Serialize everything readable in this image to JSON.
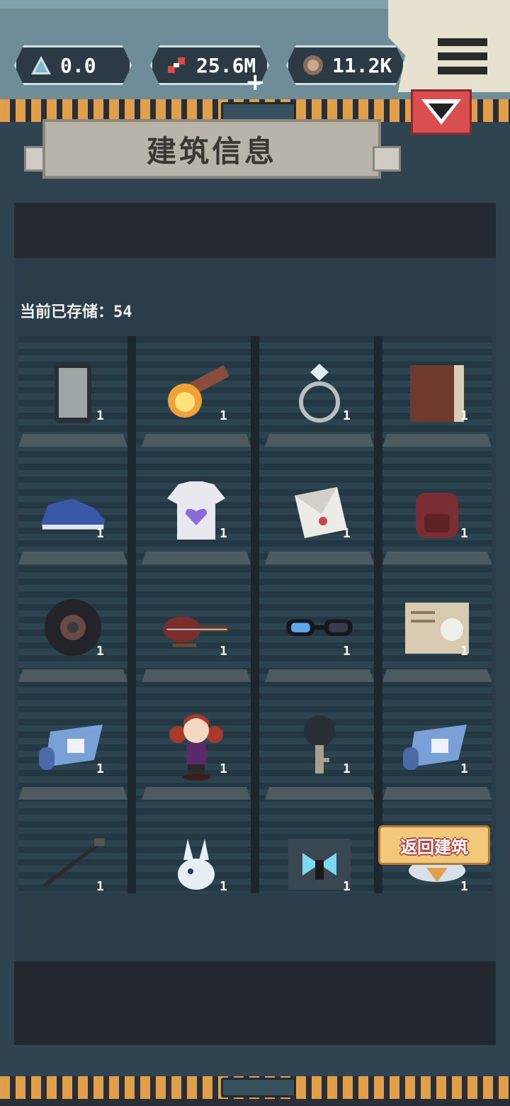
{
  "resources": [
    {
      "icon": "triangle-icon",
      "value": "0.0"
    },
    {
      "icon": "dna-icon",
      "value": "25.6M"
    },
    {
      "icon": "coin-icon",
      "value": "11.2K"
    }
  ],
  "add_label": "+",
  "title": "建筑信息",
  "storage": {
    "label": "当前已存储：",
    "count": "54"
  },
  "items": [
    {
      "icon": "phone-icon",
      "count": "1"
    },
    {
      "icon": "torch-icon",
      "count": "1"
    },
    {
      "icon": "ring-icon",
      "count": "1"
    },
    {
      "icon": "book-icon",
      "count": "1"
    },
    {
      "icon": "sneaker-icon",
      "count": "1"
    },
    {
      "icon": "tshirt-icon",
      "count": "1"
    },
    {
      "icon": "envelope-icon",
      "count": "1"
    },
    {
      "icon": "backpack-icon",
      "count": "1"
    },
    {
      "icon": "tire-icon",
      "count": "1"
    },
    {
      "icon": "guitar-icon",
      "count": "1"
    },
    {
      "icon": "goggles-icon",
      "count": "1"
    },
    {
      "icon": "certificate-icon",
      "count": "1"
    },
    {
      "icon": "scroll-icon",
      "count": "1"
    },
    {
      "icon": "figurine-icon",
      "count": "1"
    },
    {
      "icon": "key-icon",
      "count": "1"
    },
    {
      "icon": "scroll-icon",
      "count": "1"
    },
    {
      "icon": "cane-icon",
      "count": "1"
    },
    {
      "icon": "spirit-icon",
      "count": "1"
    },
    {
      "icon": "portal-icon",
      "count": "1"
    },
    {
      "icon": "crystal-icon",
      "count": "1"
    }
  ],
  "return_button": "返回建筑",
  "colors": {
    "accent": "#e0a04a",
    "danger": "#d94f4f",
    "panel": "#2f4450"
  }
}
